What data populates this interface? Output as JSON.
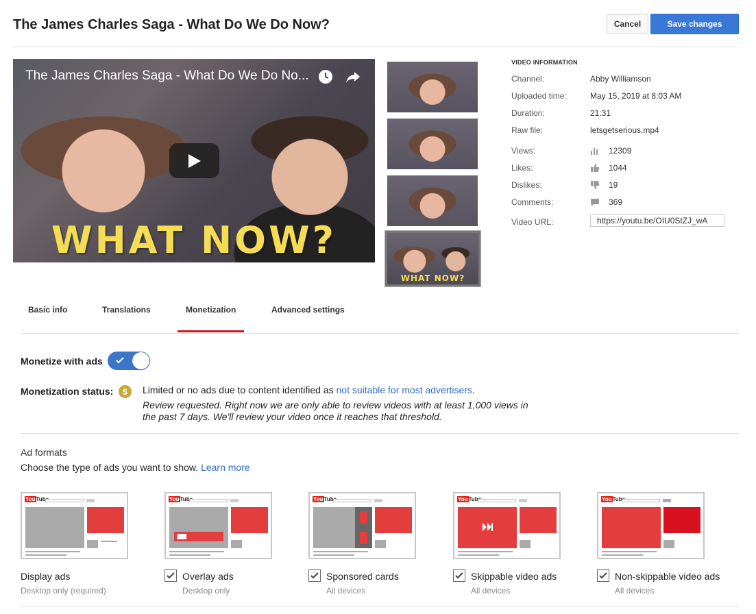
{
  "header": {
    "title": "The James Charles Saga - What Do We Do Now?",
    "cancel": "Cancel",
    "save": "Save changes"
  },
  "player": {
    "title": "The James Charles Saga - What Do We Do No...",
    "overlay_text": "WHAT NOW?"
  },
  "thumbnails": [
    {
      "label": ""
    },
    {
      "label": ""
    },
    {
      "label": ""
    },
    {
      "label": "WHAT NOW?"
    }
  ],
  "video_info": {
    "heading": "VIDEO INFORMATION",
    "channel_label": "Channel:",
    "channel": "Abby Williamson",
    "uploaded_label": "Uploaded time:",
    "uploaded": "May 15, 2019 at 8:03 AM",
    "duration_label": "Duration:",
    "duration": "21:31",
    "rawfile_label": "Raw file:",
    "rawfile": "letsgetserious.mp4",
    "views_label": "Views:",
    "views": "12309",
    "likes_label": "Likes:",
    "likes": "1044",
    "dislikes_label": "Dislikes:",
    "dislikes": "19",
    "comments_label": "Comments:",
    "comments": "369",
    "url_label": "Video URL:",
    "url": "https://youtu.be/OIU0StZJ_wA"
  },
  "tabs": [
    {
      "label": "Basic info"
    },
    {
      "label": "Translations"
    },
    {
      "label": "Monetization"
    },
    {
      "label": "Advanced settings"
    }
  ],
  "monetization": {
    "monetize_label": "Monetize with ads",
    "monetize_on": true,
    "status_label": "Monetization status:",
    "status_text": "Limited or no ads due to content identified as ",
    "status_link": "not suitable for most advertisers",
    "status_end": ".",
    "note": "Review requested.   Right now we are only able to review videos with at least 1,000 views in the past 7 days.   We'll review your video once it reaches that threshold."
  },
  "ad_formats": {
    "title": "Ad formats",
    "desc": "Choose the type of ads you want to show. ",
    "learn_more": "Learn more",
    "items": [
      {
        "label": "Display ads",
        "sub": "Desktop only (required)",
        "checkable": false
      },
      {
        "label": "Overlay ads",
        "sub": "Desktop only",
        "checkable": true,
        "checked": true
      },
      {
        "label": "Sponsored cards",
        "sub": "All devices",
        "checkable": true,
        "checked": true
      },
      {
        "label": "Skippable video ads",
        "sub": "All devices",
        "checkable": true,
        "checked": true
      },
      {
        "label": "Non-skippable video ads",
        "sub": "All devices",
        "checkable": true,
        "checked": true
      }
    ],
    "preview_logo": "You"
  },
  "colors": {
    "accent": "#3a78d8",
    "red": "#e62117",
    "tab_underline": "#cc181e",
    "coin": "#c9a63a"
  }
}
